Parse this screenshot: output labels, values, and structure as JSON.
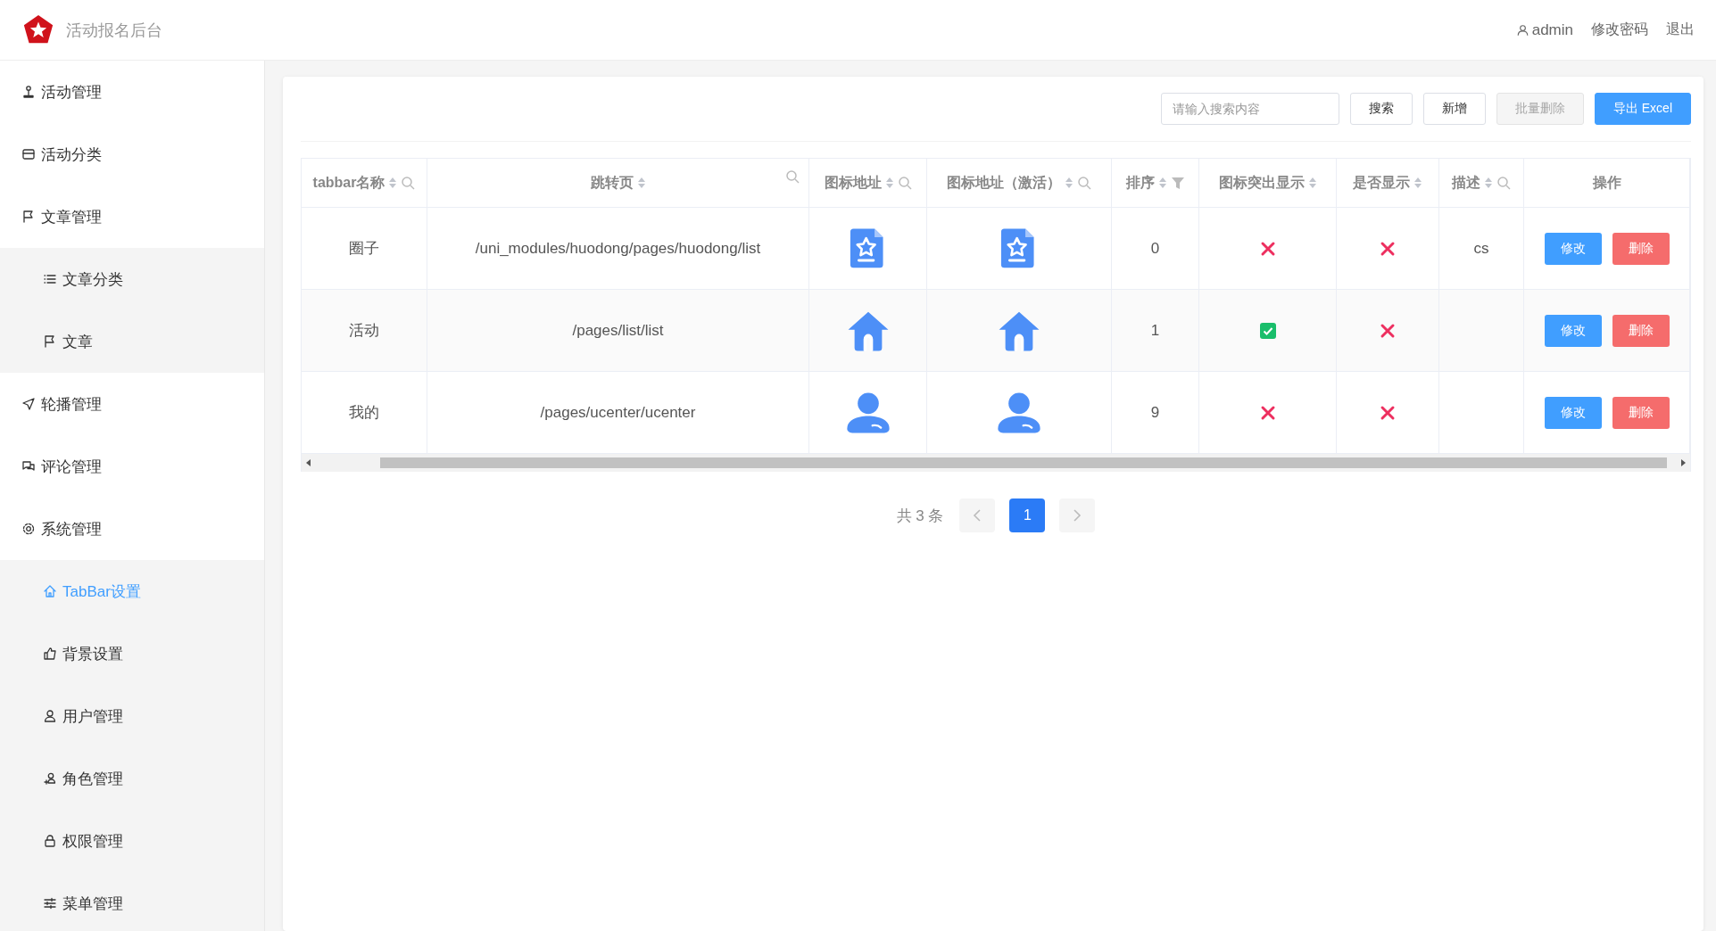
{
  "header": {
    "title": "活动报名后台",
    "user": "admin",
    "links": [
      "修改密码",
      "退出"
    ]
  },
  "sidebar": {
    "items": [
      {
        "label": "活动管理",
        "selected": false
      },
      {
        "label": "活动分类",
        "selected": false
      },
      {
        "label": "文章管理",
        "selected": false,
        "expanded": true,
        "children": [
          {
            "label": "文章分类",
            "selected": false
          },
          {
            "label": "文章",
            "selected": false
          }
        ]
      },
      {
        "label": "轮播管理",
        "selected": false
      },
      {
        "label": "评论管理",
        "selected": false
      },
      {
        "label": "系统管理",
        "selected": false,
        "expanded": true,
        "children": [
          {
            "label": "TabBar设置",
            "selected": true
          },
          {
            "label": "背景设置",
            "selected": false
          },
          {
            "label": "用户管理",
            "selected": false
          },
          {
            "label": "角色管理",
            "selected": false
          },
          {
            "label": "权限管理",
            "selected": false
          },
          {
            "label": "菜单管理",
            "selected": false
          }
        ]
      }
    ]
  },
  "toolbar": {
    "search": {
      "placeholder": "请输入搜索内容"
    },
    "buttons": [
      {
        "label": "搜索",
        "kind": "default",
        "disabled": false
      },
      {
        "label": "新增",
        "kind": "default",
        "disabled": false
      },
      {
        "label": "批量删除",
        "kind": "default",
        "disabled": true
      },
      {
        "label": "导出 Excel",
        "kind": "primary",
        "disabled": false
      }
    ]
  },
  "table": {
    "columns": [
      {
        "label": "tabbar名称",
        "sortable": true,
        "search": true,
        "filter": false
      },
      {
        "label": "跳转页",
        "sortable": true,
        "search": true,
        "filter": false
      },
      {
        "label": "图标地址",
        "sortable": true,
        "search": true,
        "filter": false
      },
      {
        "label": "图标地址（激活）",
        "sortable": true,
        "search": true,
        "filter": false
      },
      {
        "label": "排序",
        "sortable": true,
        "search": false,
        "filter": true
      },
      {
        "label": "图标突出显示",
        "sortable": true,
        "search": false,
        "filter": false
      },
      {
        "label": "是否显示",
        "sortable": true,
        "search": false,
        "filter": false
      },
      {
        "label": "描述",
        "sortable": true,
        "search": true,
        "filter": false
      },
      {
        "label": "操作",
        "sortable": false,
        "search": false,
        "filter": false
      }
    ],
    "rows": [
      {
        "name": "圈子",
        "path": "/uni_modules/huodong/pages/huodong/list",
        "order": "0",
        "highlight": false,
        "visible": false,
        "desc": "cs",
        "actions": [
          "修改",
          "删除"
        ]
      },
      {
        "name": "活动",
        "path": "/pages/list/list",
        "order": "1",
        "highlight": true,
        "visible": false,
        "actions": [
          "修改",
          "删除"
        ]
      },
      {
        "name": "我的",
        "path": "/pages/ucenter/ucenter",
        "order": "9",
        "highlight": false,
        "visible": false,
        "actions": [
          "修改",
          "删除"
        ]
      }
    ]
  },
  "pagination": {
    "total": "共 3 条",
    "pages": [
      {
        "label": "1",
        "selected": true
      }
    ]
  }
}
